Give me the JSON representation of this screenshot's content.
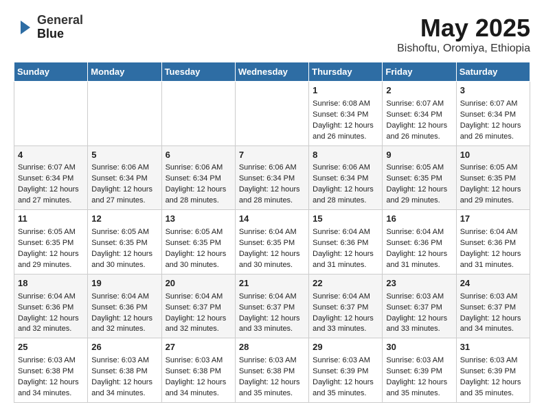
{
  "header": {
    "logo_line1": "General",
    "logo_line2": "Blue",
    "month": "May 2025",
    "location": "Bishoftu, Oromiya, Ethiopia"
  },
  "days_of_week": [
    "Sunday",
    "Monday",
    "Tuesday",
    "Wednesday",
    "Thursday",
    "Friday",
    "Saturday"
  ],
  "weeks": [
    [
      {
        "day": "",
        "info": ""
      },
      {
        "day": "",
        "info": ""
      },
      {
        "day": "",
        "info": ""
      },
      {
        "day": "",
        "info": ""
      },
      {
        "day": "1",
        "info": "Sunrise: 6:08 AM\nSunset: 6:34 PM\nDaylight: 12 hours\nand 26 minutes."
      },
      {
        "day": "2",
        "info": "Sunrise: 6:07 AM\nSunset: 6:34 PM\nDaylight: 12 hours\nand 26 minutes."
      },
      {
        "day": "3",
        "info": "Sunrise: 6:07 AM\nSunset: 6:34 PM\nDaylight: 12 hours\nand 26 minutes."
      }
    ],
    [
      {
        "day": "4",
        "info": "Sunrise: 6:07 AM\nSunset: 6:34 PM\nDaylight: 12 hours\nand 27 minutes."
      },
      {
        "day": "5",
        "info": "Sunrise: 6:06 AM\nSunset: 6:34 PM\nDaylight: 12 hours\nand 27 minutes."
      },
      {
        "day": "6",
        "info": "Sunrise: 6:06 AM\nSunset: 6:34 PM\nDaylight: 12 hours\nand 28 minutes."
      },
      {
        "day": "7",
        "info": "Sunrise: 6:06 AM\nSunset: 6:34 PM\nDaylight: 12 hours\nand 28 minutes."
      },
      {
        "day": "8",
        "info": "Sunrise: 6:06 AM\nSunset: 6:34 PM\nDaylight: 12 hours\nand 28 minutes."
      },
      {
        "day": "9",
        "info": "Sunrise: 6:05 AM\nSunset: 6:35 PM\nDaylight: 12 hours\nand 29 minutes."
      },
      {
        "day": "10",
        "info": "Sunrise: 6:05 AM\nSunset: 6:35 PM\nDaylight: 12 hours\nand 29 minutes."
      }
    ],
    [
      {
        "day": "11",
        "info": "Sunrise: 6:05 AM\nSunset: 6:35 PM\nDaylight: 12 hours\nand 29 minutes."
      },
      {
        "day": "12",
        "info": "Sunrise: 6:05 AM\nSunset: 6:35 PM\nDaylight: 12 hours\nand 30 minutes."
      },
      {
        "day": "13",
        "info": "Sunrise: 6:05 AM\nSunset: 6:35 PM\nDaylight: 12 hours\nand 30 minutes."
      },
      {
        "day": "14",
        "info": "Sunrise: 6:04 AM\nSunset: 6:35 PM\nDaylight: 12 hours\nand 30 minutes."
      },
      {
        "day": "15",
        "info": "Sunrise: 6:04 AM\nSunset: 6:36 PM\nDaylight: 12 hours\nand 31 minutes."
      },
      {
        "day": "16",
        "info": "Sunrise: 6:04 AM\nSunset: 6:36 PM\nDaylight: 12 hours\nand 31 minutes."
      },
      {
        "day": "17",
        "info": "Sunrise: 6:04 AM\nSunset: 6:36 PM\nDaylight: 12 hours\nand 31 minutes."
      }
    ],
    [
      {
        "day": "18",
        "info": "Sunrise: 6:04 AM\nSunset: 6:36 PM\nDaylight: 12 hours\nand 32 minutes."
      },
      {
        "day": "19",
        "info": "Sunrise: 6:04 AM\nSunset: 6:36 PM\nDaylight: 12 hours\nand 32 minutes."
      },
      {
        "day": "20",
        "info": "Sunrise: 6:04 AM\nSunset: 6:37 PM\nDaylight: 12 hours\nand 32 minutes."
      },
      {
        "day": "21",
        "info": "Sunrise: 6:04 AM\nSunset: 6:37 PM\nDaylight: 12 hours\nand 33 minutes."
      },
      {
        "day": "22",
        "info": "Sunrise: 6:04 AM\nSunset: 6:37 PM\nDaylight: 12 hours\nand 33 minutes."
      },
      {
        "day": "23",
        "info": "Sunrise: 6:03 AM\nSunset: 6:37 PM\nDaylight: 12 hours\nand 33 minutes."
      },
      {
        "day": "24",
        "info": "Sunrise: 6:03 AM\nSunset: 6:37 PM\nDaylight: 12 hours\nand 34 minutes."
      }
    ],
    [
      {
        "day": "25",
        "info": "Sunrise: 6:03 AM\nSunset: 6:38 PM\nDaylight: 12 hours\nand 34 minutes."
      },
      {
        "day": "26",
        "info": "Sunrise: 6:03 AM\nSunset: 6:38 PM\nDaylight: 12 hours\nand 34 minutes."
      },
      {
        "day": "27",
        "info": "Sunrise: 6:03 AM\nSunset: 6:38 PM\nDaylight: 12 hours\nand 34 minutes."
      },
      {
        "day": "28",
        "info": "Sunrise: 6:03 AM\nSunset: 6:38 PM\nDaylight: 12 hours\nand 35 minutes."
      },
      {
        "day": "29",
        "info": "Sunrise: 6:03 AM\nSunset: 6:39 PM\nDaylight: 12 hours\nand 35 minutes."
      },
      {
        "day": "30",
        "info": "Sunrise: 6:03 AM\nSunset: 6:39 PM\nDaylight: 12 hours\nand 35 minutes."
      },
      {
        "day": "31",
        "info": "Sunrise: 6:03 AM\nSunset: 6:39 PM\nDaylight: 12 hours\nand 35 minutes."
      }
    ]
  ]
}
